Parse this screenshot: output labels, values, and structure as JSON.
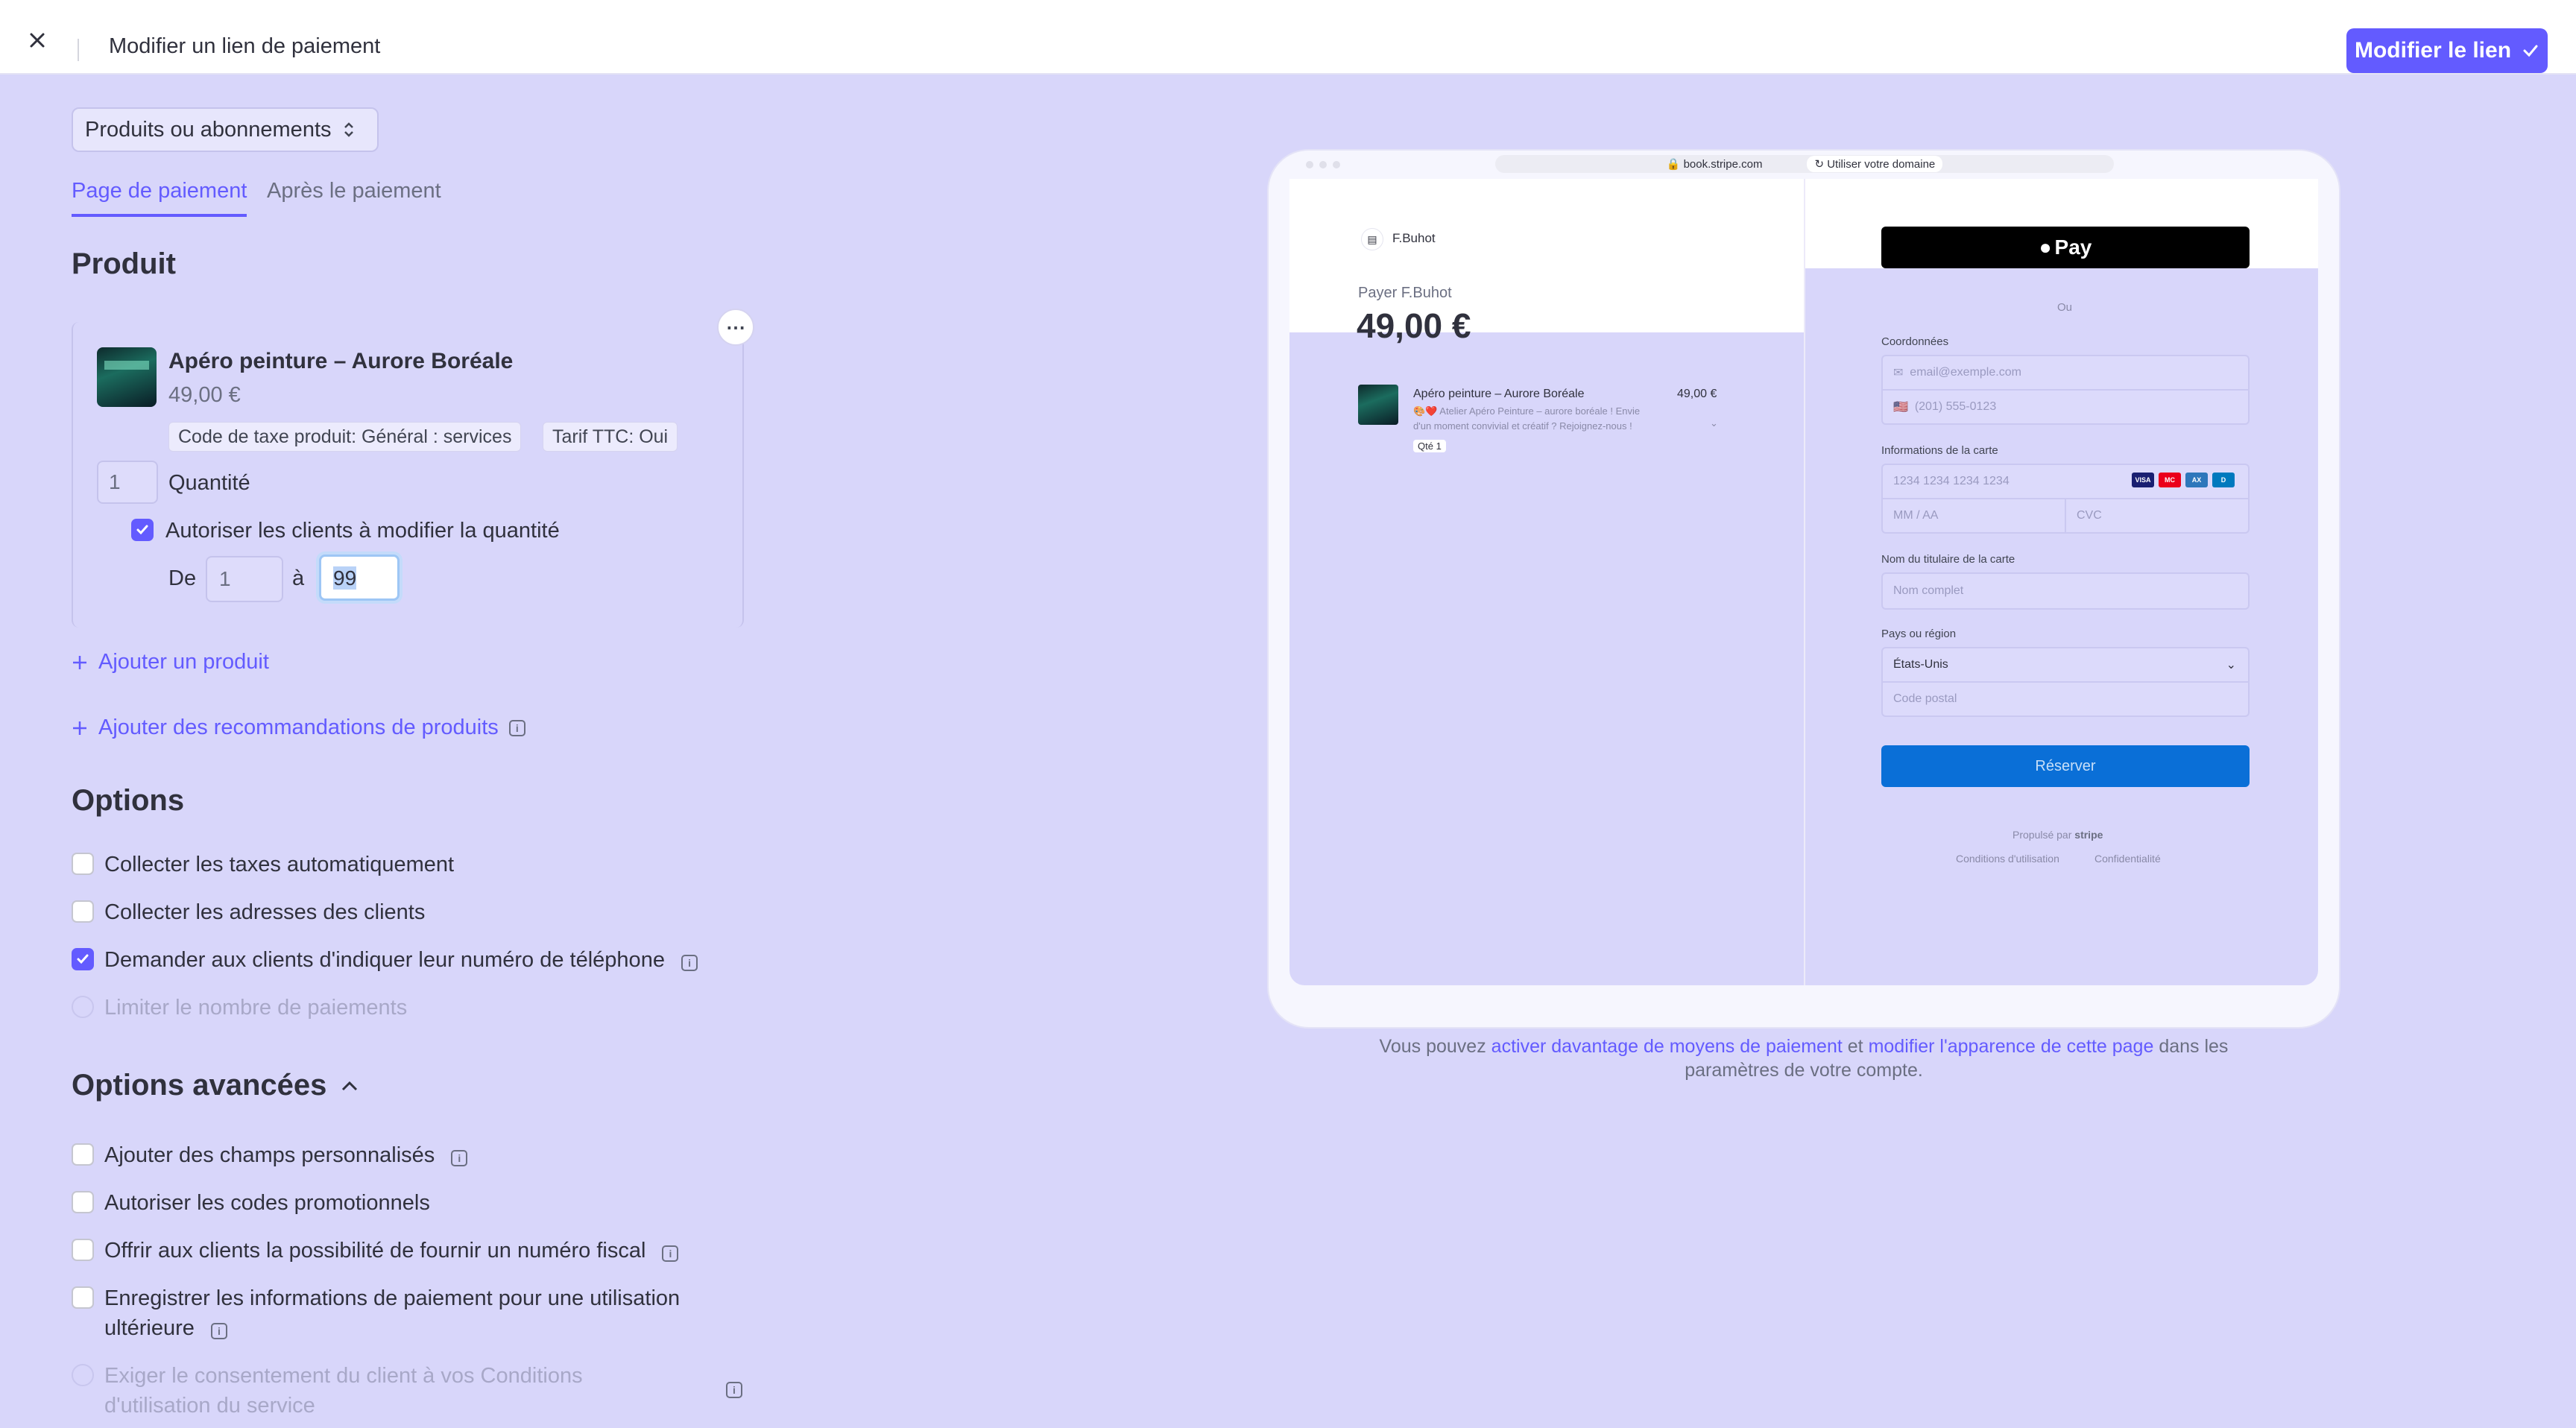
{
  "topbar": {
    "title": "Modifier un lien de paiement",
    "primary_button": "Modifier le lien"
  },
  "product_select": {
    "value": "Produits ou abonnements"
  },
  "tabs": [
    {
      "label": "Page de paiement",
      "active": true
    },
    {
      "label": "Après le paiement",
      "active": false
    }
  ],
  "product_section": {
    "title": "Produit",
    "product": {
      "name": "Apéro peinture – Aurore Boréale",
      "price": "49,00 €",
      "tags": [
        "Code de taxe produit: Général : services",
        "Tarif TTC: Oui"
      ]
    },
    "quantity": {
      "value": "1",
      "label": "Quantité"
    },
    "allow_adjust_label": "Autoriser les clients à modifier la quantité",
    "range": {
      "from_label": "De",
      "from_value": "1",
      "to_label": "à",
      "to_value": "99"
    },
    "add_product": "Ajouter un produit",
    "add_recommendations": "Ajouter des recommandations de produits"
  },
  "options": {
    "title": "Options",
    "items": [
      {
        "label": "Collecter les taxes automatiquement",
        "checked": false
      },
      {
        "label": "Collecter les adresses des clients",
        "checked": false
      },
      {
        "label": "Demander aux clients d'indiquer leur numéro de téléphone",
        "checked": true
      },
      {
        "label": "Limiter le nombre de paiements",
        "checked": false,
        "disabled": true
      }
    ]
  },
  "advanced": {
    "title": "Options avancées",
    "items": [
      {
        "label": "Ajouter des champs personnalisés",
        "checked": false
      },
      {
        "label": "Autoriser les codes promotionnels",
        "checked": false
      },
      {
        "label": "Offrir aux clients la possibilité de fournir un numéro fiscal",
        "checked": false
      },
      {
        "label_line1": "Enregistrer les informations de paiement pour une utilisation",
        "label_line2": "ultérieure",
        "checked": false
      },
      {
        "label_line1": "Exiger le consentement du client à vos Conditions",
        "label_line2": "d'utilisation du service",
        "checked": false,
        "disabled": true
      }
    ]
  },
  "preview": {
    "url": "book.stripe.com",
    "domain_button": "Utiliser votre domaine",
    "merchant": "F.Buhot",
    "pay_label": "Payer F.Buhot",
    "amount": "49,00 €",
    "item": {
      "name": "Apéro peinture – Aurore Boréale",
      "price": "49,00 €",
      "desc_line1": "🎨❤️ Atelier Apéro Peinture – aurore boréale ! Envie",
      "desc_line2": "d'un moment convivial et créatif ? Rejoignez-nous !",
      "qty": "Qté 1"
    },
    "applepay": "Pay",
    "or": "Ou",
    "contact_label": "Coordonnées",
    "email_placeholder": "email@exemple.com",
    "phone_placeholder": "(201) 555-0123",
    "card_label": "Informations de la carte",
    "card_placeholder": "1234 1234 1234 1234",
    "expiry_placeholder": "MM / AA",
    "cvc_placeholder": "CVC",
    "holder_label": "Nom du titulaire de la carte",
    "holder_placeholder": "Nom complet",
    "country_label": "Pays ou région",
    "country_value": "États-Unis",
    "postal_placeholder": "Code postal",
    "submit": "Réserver",
    "powered_by": "Propulsé par",
    "powered_brand": "stripe",
    "terms": "Conditions d'utilisation",
    "privacy": "Confidentialité"
  },
  "footer": {
    "part1": "Vous pouvez ",
    "link1": "activer davantage de moyens de paiement",
    "part2": " et ",
    "link2": "modifier l'apparence de cette page",
    "part3": " dans les",
    "line2": "paramètres de votre compte."
  },
  "colors": {
    "accent": "#635bff",
    "background": "#d8d6fa",
    "pay_button": "#0a6fd7"
  }
}
